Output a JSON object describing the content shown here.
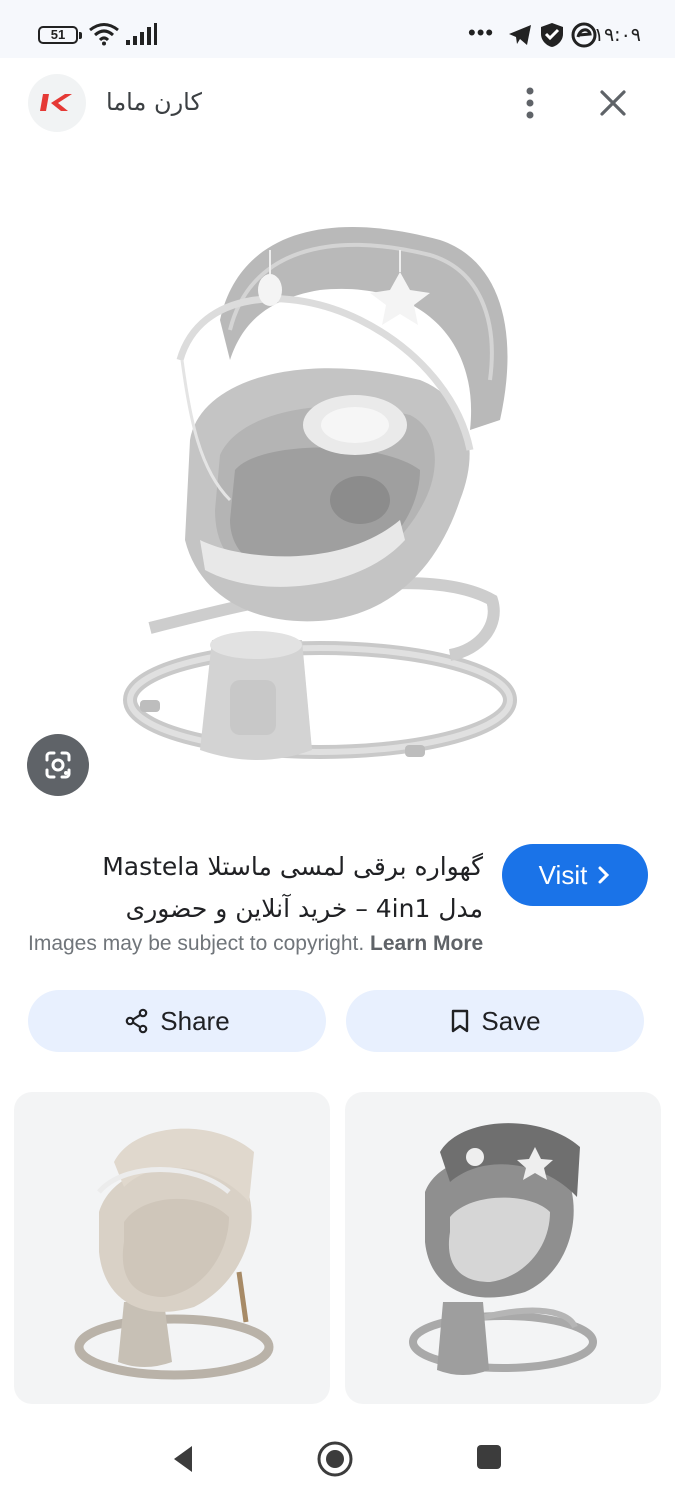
{
  "status_bar": {
    "battery": "51",
    "time": "۱۹:۰۹",
    "more": "•••"
  },
  "header": {
    "site_name": "کارن ماما",
    "logo_icon": "karen-mama-logo",
    "more_icon": "more-vert-icon",
    "close_icon": "close-icon"
  },
  "main_image": {
    "subject": "Mastela baby swing",
    "lens_icon": "google-lens-icon"
  },
  "result": {
    "title_line1": "گهواره برقی لمسی ماستلا Mastela",
    "title_line2": "مدل 4in1 – خرید آنلاین و حضوری",
    "visit_label": "Visit",
    "copyright_text": "Images may be subject to copyright.",
    "learn_more": "Learn More",
    "share_label": "Share",
    "save_label": "Save"
  },
  "related": [
    {
      "variant": "beige"
    },
    {
      "variant": "grey"
    }
  ],
  "colors": {
    "accent": "#1a73e8",
    "button_bg": "#e8f0fe",
    "logo_red": "#e53935"
  }
}
